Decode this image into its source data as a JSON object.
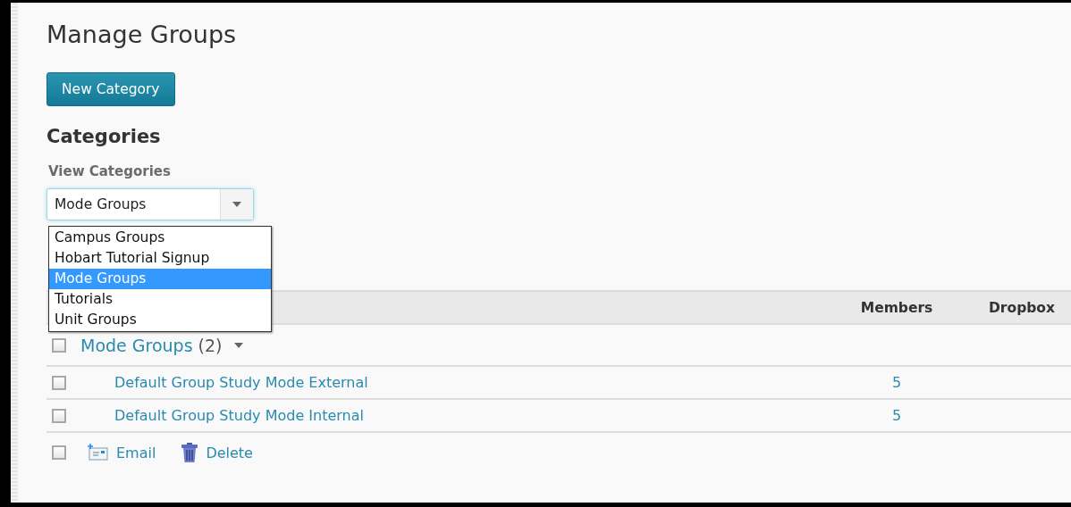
{
  "page": {
    "title": "Manage Groups"
  },
  "new_category_button": "New Category",
  "categories_heading": "Categories",
  "view_categories": {
    "label": "View Categories",
    "value": "Mode Groups",
    "expanded": true,
    "options": [
      {
        "label": "Campus Groups",
        "selected": false
      },
      {
        "label": "Hobart Tutorial Signup",
        "selected": false
      },
      {
        "label": "Mode Groups",
        "selected": true
      },
      {
        "label": "Tutorials",
        "selected": false
      },
      {
        "label": "Unit Groups",
        "selected": false
      }
    ]
  },
  "table": {
    "columns": [
      "Members",
      "Dropbox"
    ],
    "category_row": {
      "name": "Mode Groups",
      "count": "(2)",
      "checked": false
    },
    "rows": [
      {
        "name": "Default Group Study Mode External",
        "members": "5",
        "checked": false
      },
      {
        "name": "Default Group Study Mode Internal",
        "members": "5",
        "checked": false
      }
    ],
    "select_all_checked": false,
    "actions": [
      {
        "kind": "email",
        "label": "Email"
      },
      {
        "kind": "delete",
        "label": "Delete"
      }
    ]
  }
}
